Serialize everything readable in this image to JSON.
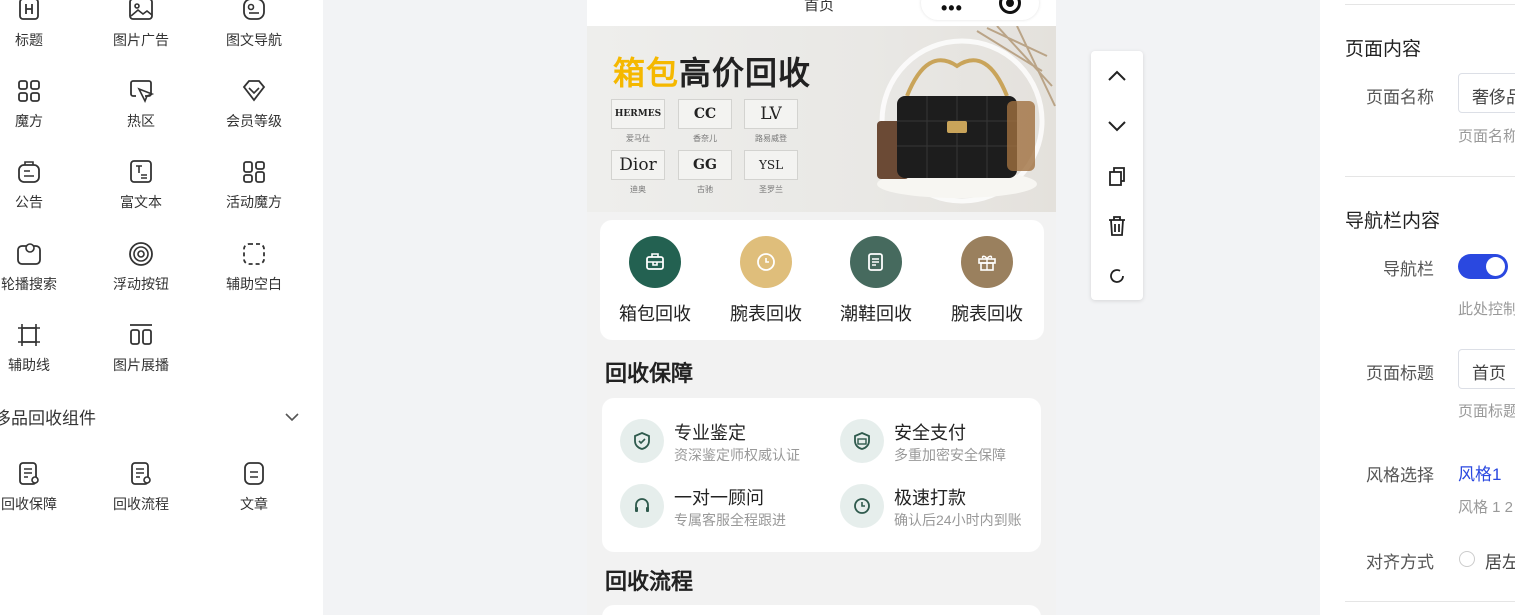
{
  "palette": {
    "items": [
      {
        "label": "标题",
        "icon": "title-icon"
      },
      {
        "label": "图片广告",
        "icon": "image-ad-icon"
      },
      {
        "label": "图文导航",
        "icon": "image-text-nav-icon"
      },
      {
        "label": "魔方",
        "icon": "cube-grid-icon"
      },
      {
        "label": "热区",
        "icon": "hotspot-icon"
      },
      {
        "label": "会员等级",
        "icon": "member-level-icon"
      },
      {
        "label": "公告",
        "icon": "notice-icon"
      },
      {
        "label": "富文本",
        "icon": "rich-text-icon"
      },
      {
        "label": "活动魔方",
        "icon": "activity-cube-icon"
      },
      {
        "label": "轮播搜索",
        "icon": "carousel-search-icon"
      },
      {
        "label": "浮动按钮",
        "icon": "float-button-icon"
      },
      {
        "label": "辅助空白",
        "icon": "blank-space-icon"
      },
      {
        "label": "辅助线",
        "icon": "guide-line-icon"
      },
      {
        "label": "图片展播",
        "icon": "image-show-icon"
      }
    ],
    "group_title": "侈品回收组件",
    "group_items": [
      {
        "label": "回收保障",
        "icon": "recycle-guarantee-icon"
      },
      {
        "label": "回收流程",
        "icon": "recycle-flow-icon"
      },
      {
        "label": "文章",
        "icon": "article-icon"
      }
    ]
  },
  "phone": {
    "page_title": "首页",
    "banner": {
      "title_highlight": "箱包",
      "title_rest": "高价回收",
      "brands": [
        {
          "logo": "HERMES",
          "name": "爱马仕"
        },
        {
          "logo": "CC",
          "name": "香奈儿"
        },
        {
          "logo": "LV",
          "name": "路易威登"
        },
        {
          "logo": "Dior",
          "name": "迪奥"
        },
        {
          "logo": "GG",
          "name": "古驰"
        },
        {
          "logo": "YSL",
          "name": "圣罗兰"
        }
      ]
    },
    "quick_nav": [
      {
        "label": "箱包回收",
        "color": "#236151"
      },
      {
        "label": "腕表回收",
        "color": "#dfbe7b"
      },
      {
        "label": "潮鞋回收",
        "color": "#466a5e"
      },
      {
        "label": "腕表回收",
        "color": "#9a805e"
      }
    ],
    "guarantee_title": "回收保障",
    "guarantees": [
      {
        "title": "专业鉴定",
        "sub": "资深鉴定师权威认证",
        "icon": "shield-check-icon"
      },
      {
        "title": "安全支付",
        "sub": "多重加密安全保障",
        "icon": "secure-pay-icon"
      },
      {
        "title": "一对一顾问",
        "sub": "专属客服全程跟进",
        "icon": "headset-icon"
      },
      {
        "title": "极速打款",
        "sub": "确认后24小时内到账",
        "icon": "clock-icon"
      }
    ],
    "flow_title": "回收流程"
  },
  "toolbar": [
    "move-up-icon",
    "move-down-icon",
    "copy-icon",
    "delete-icon",
    "reset-icon"
  ],
  "props": {
    "page_section": "页面内容",
    "page_name_label": "页面名称",
    "page_name_value": "奢侈品",
    "page_name_tip": "页面名称",
    "nav_section": "导航栏内容",
    "nav_label": "导航栏",
    "nav_tip": "此处控制",
    "page_title_label": "页面标题",
    "page_title_value": "首页",
    "page_title_tip": "页面标题",
    "style_label": "风格选择",
    "style_value": "风格1",
    "style_tip": "风格 1 2",
    "align_label": "对齐方式",
    "align_value": "居左"
  },
  "colors": {
    "accent": "#2a48e0",
    "banner_highlight": "#f5b800",
    "icon_green": "#2f5a4d"
  }
}
